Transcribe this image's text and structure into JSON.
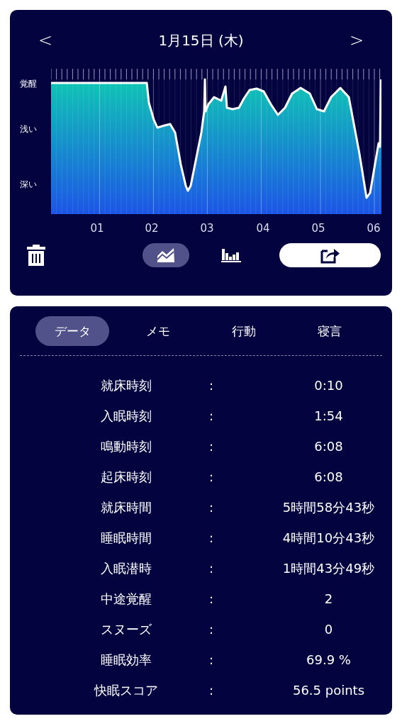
{
  "header": {
    "title": "1月15日 (木)",
    "prev": "<",
    "next": ">"
  },
  "chart": {
    "y_labels": [
      "覚醒",
      "浅い",
      "深い"
    ],
    "x_labels": [
      "01",
      "02",
      "03",
      "04",
      "05",
      "06"
    ]
  },
  "views": [
    {
      "kind": "line",
      "selected": true
    },
    {
      "kind": "bar",
      "selected": false
    }
  ],
  "tabs": [
    {
      "label": "データ",
      "selected": true
    },
    {
      "label": "メモ",
      "selected": false
    },
    {
      "label": "行動",
      "selected": false
    },
    {
      "label": "寝言",
      "selected": false
    }
  ],
  "rows": [
    {
      "label": "就床時刻",
      "sep": ":",
      "value": "0:10"
    },
    {
      "label": "入眠時刻",
      "sep": ":",
      "value": "1:54"
    },
    {
      "label": "鳴動時刻",
      "sep": ":",
      "value": "6:08"
    },
    {
      "label": "起床時刻",
      "sep": ":",
      "value": "6:08"
    },
    {
      "label": "就床時間",
      "sep": ":",
      "value": "5時間58分43秒"
    },
    {
      "label": "睡眠時間",
      "sep": ":",
      "value": "4時間10分43秒"
    },
    {
      "label": "入眠潜時",
      "sep": ":",
      "value": "1時間43分49秒"
    },
    {
      "label": "中途覚醒",
      "sep": ":",
      "value": "2"
    },
    {
      "label": "スヌーズ",
      "sep": ":",
      "value": "0"
    },
    {
      "label": "睡眠効率",
      "sep": ":",
      "value": "69.9 %"
    },
    {
      "label": "快眠スコア",
      "sep": ":",
      "value": "56.5 points"
    }
  ]
}
